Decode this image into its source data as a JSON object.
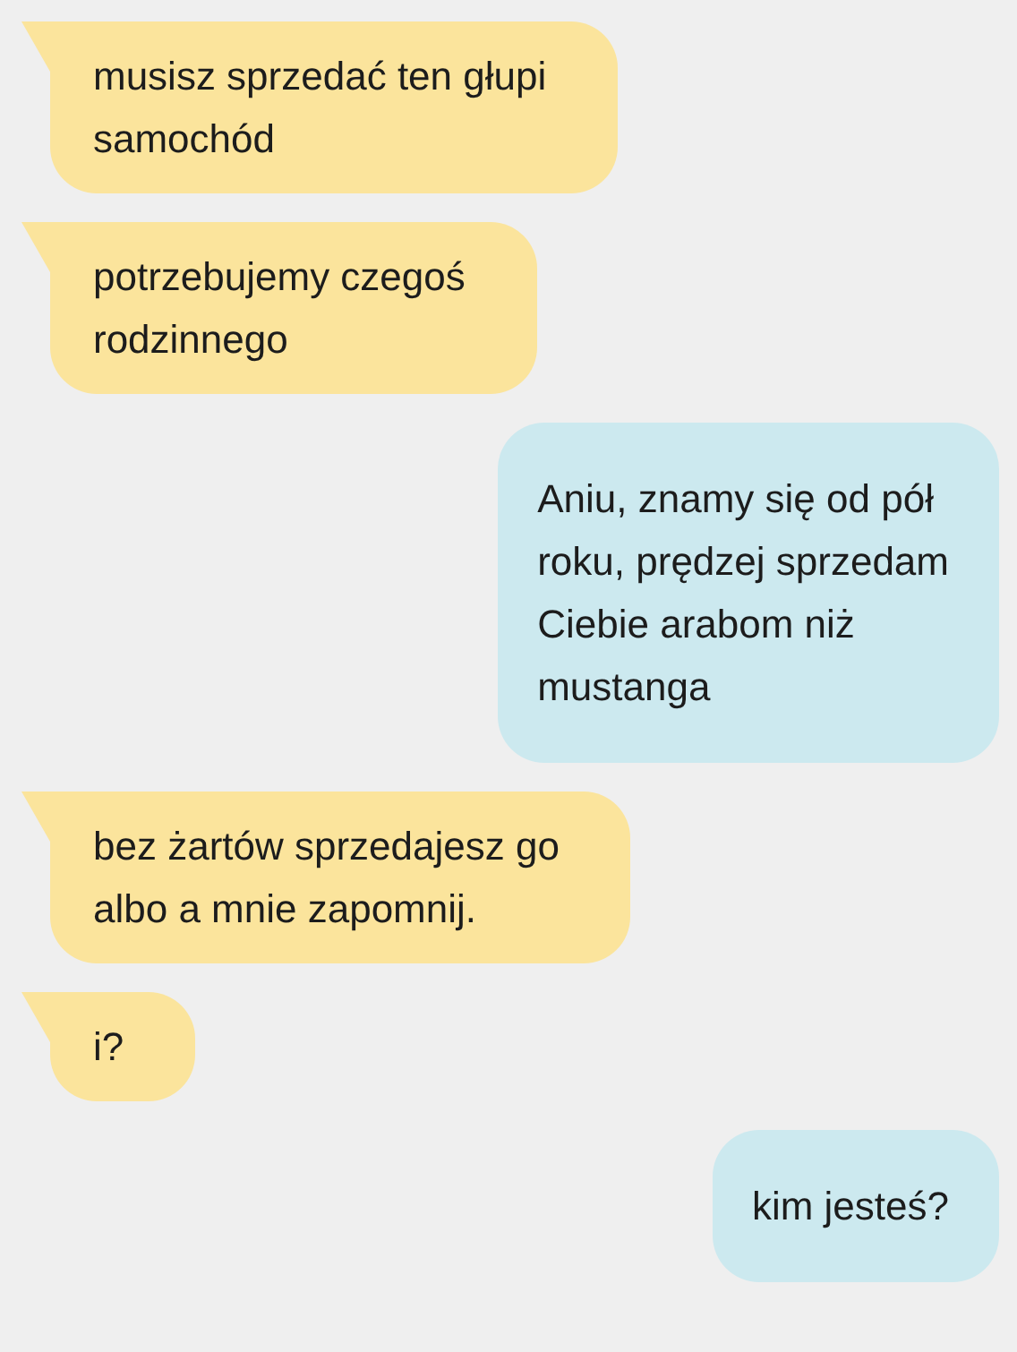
{
  "messages": [
    {
      "kind": "incoming",
      "text": "musisz sprzedać ten głupi\nsamochód"
    },
    {
      "kind": "incoming",
      "text": "potrzebujemy czegoś\nrodzinnego"
    },
    {
      "kind": "outgoing",
      "text": "Aniu, znamy się od pół\nroku, prędzej sprzedam\nCiebie arabom niż\nmustanga"
    },
    {
      "kind": "incoming",
      "text": "bez żartów sprzedajesz go\nalbo a mnie zapomnij."
    },
    {
      "kind": "incoming",
      "text": "i?"
    },
    {
      "kind": "outgoing",
      "text": "kim jesteś?"
    }
  ]
}
